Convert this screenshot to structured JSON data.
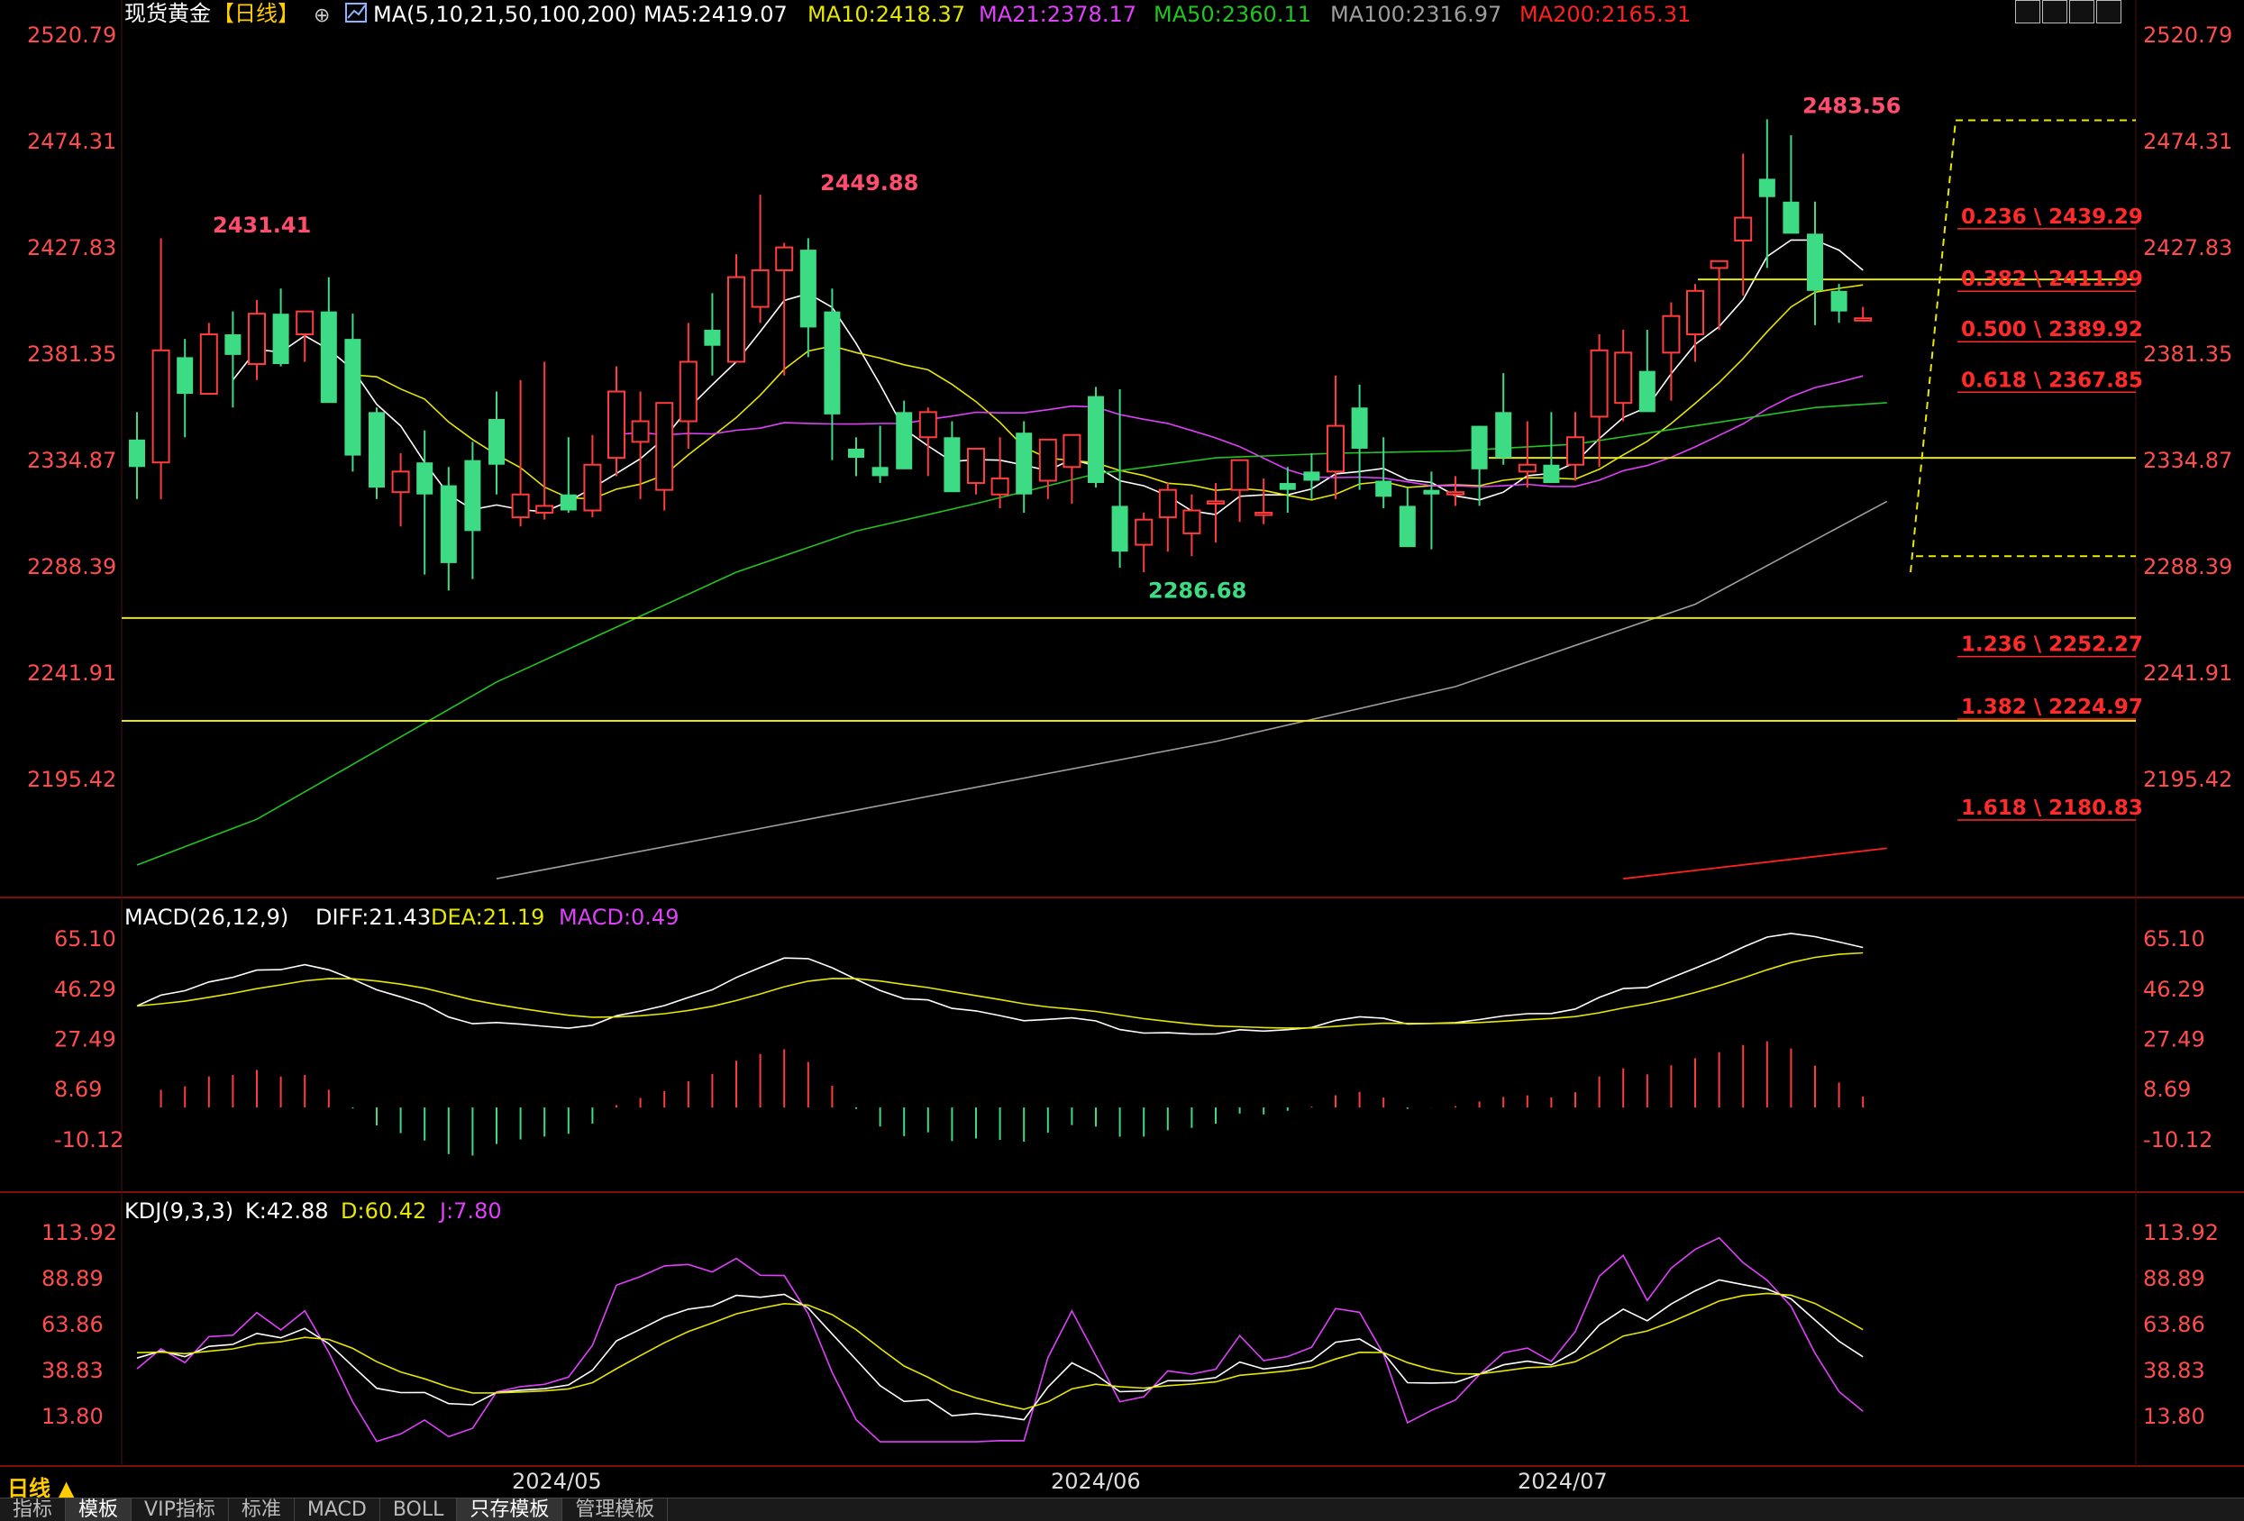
{
  "header": {
    "symbol": "现货黄金",
    "period_tag": "【日线】",
    "ma_label": "MA(5,10,21,50,100,200)",
    "ma_values": [
      {
        "label": "MA5:2419.07",
        "color": "#ffffff"
      },
      {
        "label": "MA10:2418.37",
        "color": "#e6e600"
      },
      {
        "label": "MA21:2378.17",
        "color": "#e040fb"
      },
      {
        "label": "MA50:2360.11",
        "color": "#22c422"
      },
      {
        "label": "MA100:2316.97",
        "color": "#9e9e9e"
      },
      {
        "label": "MA200:2165.31",
        "color": "#ff2020"
      }
    ]
  },
  "price_axis": [
    "2520.79",
    "2474.31",
    "2427.83",
    "2381.35",
    "2334.87",
    "2288.39",
    "2241.91",
    "2195.42"
  ],
  "annotations": {
    "high1": "2431.41",
    "high2": "2449.88",
    "low1": "2286.68",
    "high3": "2483.56"
  },
  "fib_levels": [
    {
      "label": "0.236 \\ 2439.29",
      "price": 2439.29
    },
    {
      "label": "0.382 \\ 2411.99",
      "price": 2411.99
    },
    {
      "label": "0.500 \\ 2389.92",
      "price": 2389.92
    },
    {
      "label": "0.618 \\ 2367.85",
      "price": 2367.85
    },
    {
      "label": "1.236 \\ 2252.27",
      "price": 2252.27
    },
    {
      "label": "1.382 \\ 2224.97",
      "price": 2224.97
    },
    {
      "label": "1.618 \\ 2180.83",
      "price": 2180.83
    }
  ],
  "macd": {
    "title": "MACD(26,12,9)",
    "diff": "DIFF:21.43",
    "dea": "DEA:21.19",
    "macd": "MACD:0.49",
    "axis": [
      "65.10",
      "46.29",
      "27.49",
      "8.69",
      "-10.12"
    ]
  },
  "kdj": {
    "title": "KDJ(9,3,3)",
    "k": "K:42.88",
    "d": "D:60.42",
    "j": "J:7.80",
    "axis": [
      "113.92",
      "88.89",
      "63.86",
      "38.83",
      "13.80"
    ]
  },
  "date_axis": [
    "2024/05",
    "2024/06",
    "2024/07"
  ],
  "period_button": "日线 ▲",
  "bottom_tabs": [
    "指标",
    "模板",
    "VIP指标",
    "标准",
    "MACD",
    "BOLL",
    "只存模板",
    "管理模板"
  ],
  "colors": {
    "up": "#ff3b3b",
    "down": "#3ddc84",
    "axis_text": "#ff4d4d",
    "fib_text": "#ff2a2a",
    "hline": "#e8e800"
  },
  "chart_data": {
    "type": "candlestick",
    "x": [
      "2024-04-12",
      "2024-04-15",
      "2024-04-16",
      "2024-04-17",
      "2024-04-18",
      "2024-04-19",
      "2024-04-22",
      "2024-04-23",
      "2024-04-24",
      "2024-04-25",
      "2024-04-26",
      "2024-04-29",
      "2024-04-30",
      "2024-05-01",
      "2024-05-02",
      "2024-05-03",
      "2024-05-06",
      "2024-05-07",
      "2024-05-08",
      "2024-05-09",
      "2024-05-10",
      "2024-05-13",
      "2024-05-14",
      "2024-05-15",
      "2024-05-16",
      "2024-05-17",
      "2024-05-20",
      "2024-05-21",
      "2024-05-22",
      "2024-05-23",
      "2024-05-24",
      "2024-05-27",
      "2024-05-28",
      "2024-05-29",
      "2024-05-30",
      "2024-05-31",
      "2024-06-03",
      "2024-06-04",
      "2024-06-05",
      "2024-06-06",
      "2024-06-07",
      "2024-06-10",
      "2024-06-11",
      "2024-06-12",
      "2024-06-13",
      "2024-06-14",
      "2024-06-17",
      "2024-06-18",
      "2024-06-19",
      "2024-06-20",
      "2024-06-21",
      "2024-06-24",
      "2024-06-25",
      "2024-06-26",
      "2024-06-27",
      "2024-06-28",
      "2024-07-01",
      "2024-07-02",
      "2024-07-03",
      "2024-07-04",
      "2024-07-05",
      "2024-07-08",
      "2024-07-09",
      "2024-07-10",
      "2024-07-11",
      "2024-07-12",
      "2024-07-15",
      "2024-07-16",
      "2024-07-17",
      "2024-07-18",
      "2024-07-19",
      "2024-07-22",
      "2024-07-23"
    ],
    "open": [
      2344,
      2334,
      2380,
      2364,
      2390,
      2377,
      2399,
      2390,
      2400,
      2388,
      2356,
      2321,
      2334,
      2324,
      2335,
      2353,
      2310,
      2312,
      2320,
      2313,
      2336,
      2343,
      2322,
      2352,
      2392,
      2378,
      2402,
      2418,
      2427,
      2400,
      2340,
      2332,
      2356,
      2345,
      2345,
      2325,
      2320,
      2347,
      2326,
      2332,
      2363,
      2315,
      2298,
      2310,
      2303,
      2316,
      2322,
      2311,
      2325,
      2330,
      2330,
      2358,
      2326,
      2315,
      2322,
      2320,
      2350,
      2356,
      2330,
      2333,
      2333,
      2354,
      2360,
      2374,
      2382,
      2390,
      2419,
      2431,
      2458,
      2448,
      2434,
      2409,
      2396
    ],
    "high": [
      2356,
      2432,
      2388,
      2395,
      2400,
      2405,
      2410,
      2400,
      2415,
      2399,
      2358,
      2338,
      2348,
      2332,
      2343,
      2365,
      2370,
      2378,
      2345,
      2346,
      2376,
      2365,
      2355,
      2395,
      2408,
      2425,
      2451,
      2430,
      2432,
      2410,
      2345,
      2350,
      2361,
      2358,
      2352,
      2340,
      2345,
      2352,
      2340,
      2345,
      2367,
      2366,
      2312,
      2325,
      2320,
      2325,
      2335,
      2327,
      2332,
      2338,
      2372,
      2368,
      2345,
      2323,
      2330,
      2328,
      2350,
      2373,
      2352,
      2356,
      2356,
      2390,
      2392,
      2392,
      2404,
      2412,
      2422,
      2469,
      2484,
      2477,
      2448,
      2412,
      2402
    ],
    "low": [
      2318,
      2318,
      2345,
      2364,
      2358,
      2370,
      2376,
      2378,
      2366,
      2330,
      2318,
      2306,
      2285,
      2278,
      2283,
      2320,
      2306,
      2309,
      2312,
      2310,
      2328,
      2318,
      2313,
      2340,
      2372,
      2378,
      2395,
      2372,
      2380,
      2335,
      2328,
      2325,
      2337,
      2328,
      2325,
      2320,
      2314,
      2312,
      2318,
      2316,
      2323,
      2288,
      2286,
      2295,
      2293,
      2299,
      2308,
      2307,
      2312,
      2318,
      2318,
      2322,
      2314,
      2297,
      2296,
      2315,
      2315,
      2333,
      2323,
      2325,
      2326,
      2332,
      2352,
      2362,
      2361,
      2378,
      2392,
      2407,
      2419,
      2438,
      2394,
      2395,
      2396
    ],
    "close": [
      2332,
      2383,
      2364,
      2390,
      2381,
      2399,
      2377,
      2400,
      2360,
      2337,
      2323,
      2330,
      2320,
      2290,
      2304,
      2333,
      2320,
      2315,
      2313,
      2333,
      2365,
      2352,
      2360,
      2378,
      2385,
      2415,
      2418,
      2428,
      2393,
      2355,
      2336,
      2328,
      2331,
      2356,
      2321,
      2340,
      2327,
      2320,
      2344,
      2346,
      2325,
      2295,
      2309,
      2322,
      2313,
      2317,
      2335,
      2312,
      2322,
      2326,
      2350,
      2340,
      2319,
      2297,
      2320,
      2321,
      2331,
      2336,
      2333,
      2325,
      2345,
      2383,
      2382,
      2356,
      2398,
      2409,
      2422,
      2441,
      2450,
      2434,
      2409,
      2400,
      2397
    ]
  }
}
